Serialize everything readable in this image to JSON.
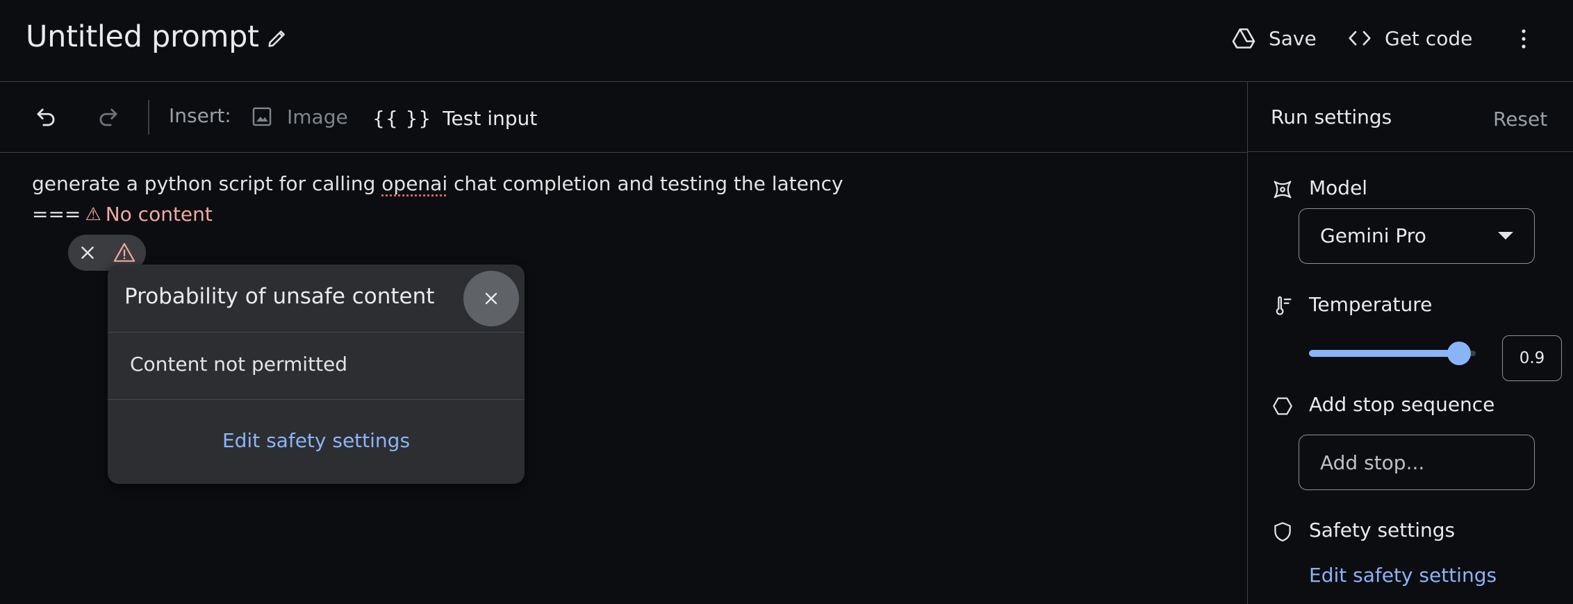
{
  "header": {
    "title": "Untitled prompt",
    "save_label": "Save",
    "get_code_label": "Get code"
  },
  "toolbar": {
    "insert_label": "Insert:",
    "image_label": "Image",
    "braces": "{{ }}",
    "test_input_label": "Test input"
  },
  "prompt": {
    "text_before": "generate a python script for calling ",
    "text_misspelled": "openai",
    "text_after": " chat completion and testing the latency",
    "result_prefix": "===",
    "result_warning_glyph": "⚠",
    "result_label": "No content"
  },
  "popup": {
    "title": "Probability of unsafe content",
    "message": "Content not permitted",
    "link": "Edit safety settings"
  },
  "run_settings": {
    "title": "Run settings",
    "reset_label": "Reset",
    "model_label": "Model",
    "model_value": "Gemini Pro",
    "temperature_label": "Temperature",
    "temperature_value": "0.9",
    "temperature_fraction": 0.9,
    "stop_label": "Add stop sequence",
    "stop_placeholder": "Add stop...",
    "safety_label": "Safety settings",
    "safety_link": "Edit safety settings"
  },
  "colors": {
    "background": "#0b0d10",
    "accent": "#8ab4f8",
    "warning": "#f2a9a0"
  },
  "icons": {
    "title_edit": "pencil-icon",
    "save": "drive-icon",
    "get_code": "code-icon",
    "more": "more-vert-icon",
    "undo": "undo-icon",
    "redo": "redo-icon",
    "image": "image-icon",
    "model": "model-icon",
    "temperature": "thermometer-icon",
    "stop_sequence": "hexagon-icon",
    "safety": "shield-icon"
  }
}
